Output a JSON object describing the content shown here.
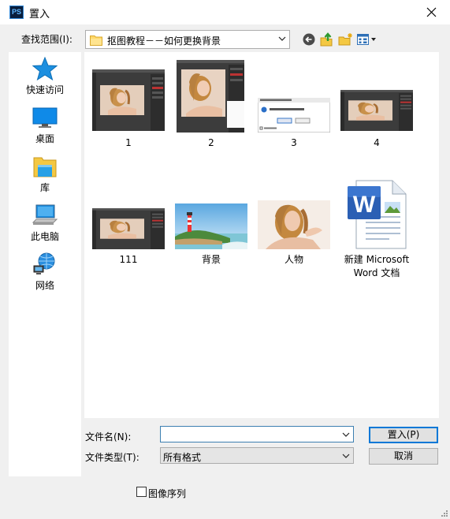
{
  "window": {
    "title": "置入",
    "app_icon": "PS",
    "close": "close-icon"
  },
  "lookin": {
    "label": "查找范围(I):",
    "value": "抠图教程－－如何更换背景"
  },
  "toolbar": [
    "back-arrow-icon",
    "up-folder-icon",
    "new-folder-icon",
    "view-menu-icon"
  ],
  "places": [
    {
      "label": "快速访问",
      "icon": "star-icon"
    },
    {
      "label": "桌面",
      "icon": "desktop-icon"
    },
    {
      "label": "库",
      "icon": "library-icon"
    },
    {
      "label": "此电脑",
      "icon": "computer-icon"
    },
    {
      "label": "网络",
      "icon": "network-icon"
    }
  ],
  "files": [
    {
      "label": "1",
      "type": "ps-screenshot"
    },
    {
      "label": "2",
      "type": "ps-screenshot"
    },
    {
      "label": "3",
      "type": "dialog-screenshot"
    },
    {
      "label": "4",
      "type": "ps-screenshot"
    },
    {
      "label": "111",
      "type": "ps-screenshot"
    },
    {
      "label": "背景",
      "type": "landscape"
    },
    {
      "label": "人物",
      "type": "portrait"
    },
    {
      "label_line1": "新建 Microsoft",
      "label_line2": "Word 文档",
      "type": "word-document"
    }
  ],
  "filename": {
    "label": "文件名(N):",
    "value": ""
  },
  "filetype": {
    "label": "文件类型(T):",
    "value": "所有格式"
  },
  "buttons": {
    "place": "置入(P)",
    "cancel": "取消"
  },
  "image_sequence": {
    "label": "图像序列",
    "checked": false
  },
  "colors": {
    "accent": "#0078d7",
    "window_bg": "#f0f0f0"
  }
}
